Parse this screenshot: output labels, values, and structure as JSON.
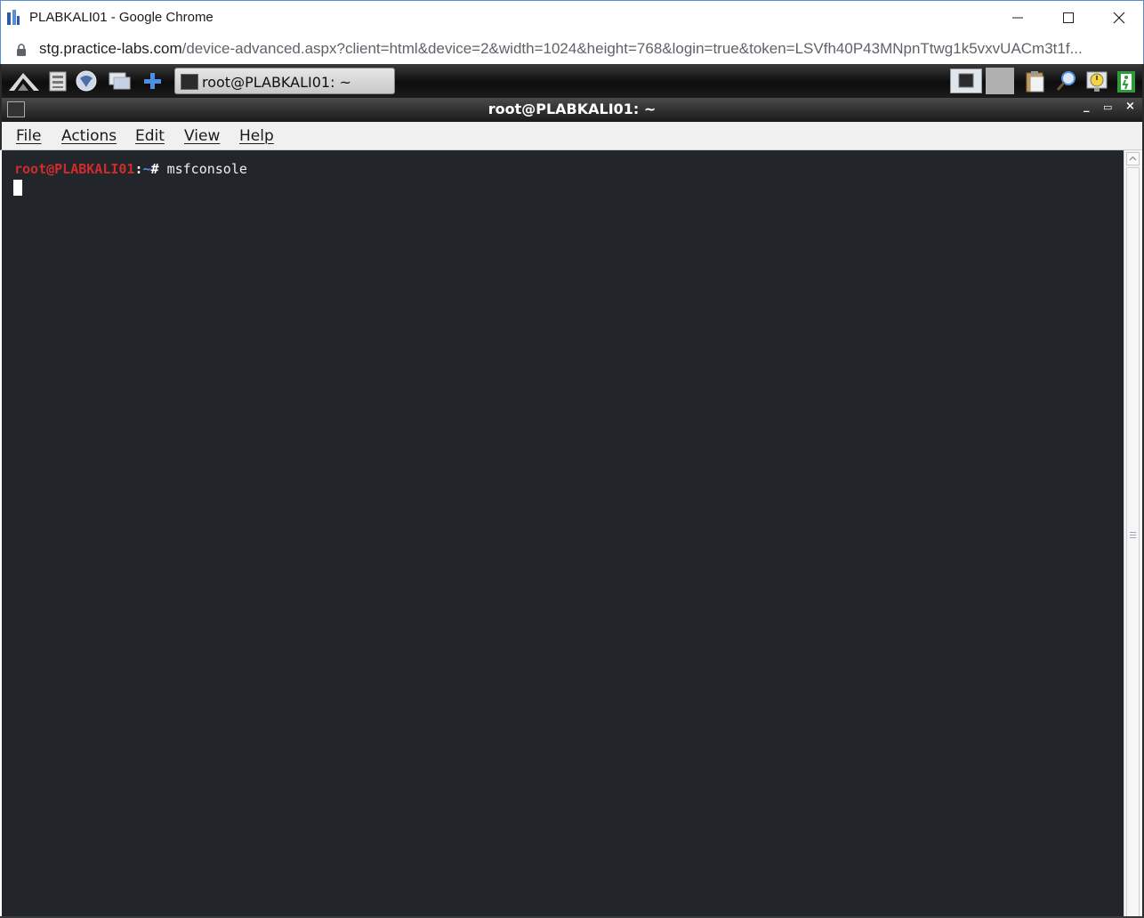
{
  "browser": {
    "window_title": "PLABKALI01 - Google Chrome",
    "url_host": "stg.practice-labs.com",
    "url_rest": "/device-advanced.aspx?client=html&device=2&width=1024&height=768&login=true&token=LSVfh40P43MNpnTtwg1k5vxvUACm3t1f..."
  },
  "panel": {
    "task_label": "root@PLABKALI01: ~",
    "icons": [
      "kali-menu-icon",
      "file-manager-icon",
      "web-browser-icon",
      "show-desktop-icon",
      "add-icon"
    ],
    "tray_icons": [
      "terminal-tray-icon",
      "clipboard-icon",
      "search-icon",
      "clock-icon",
      "logout-icon"
    ]
  },
  "terminal": {
    "window_title": "root@PLABKALI01: ~",
    "controls": {
      "minimize": "_",
      "maximize": "▭",
      "close": "×"
    },
    "menu": [
      "File",
      "Actions",
      "Edit",
      "View",
      "Help"
    ],
    "prompt_user": "root@PLABKALI01",
    "prompt_sep": ":",
    "prompt_path": "~",
    "prompt_hash": "#",
    "command": "msfconsole"
  },
  "colors": {
    "terminal_bg": "#22252a",
    "prompt_user": "#d02c2c",
    "prompt_path": "#4d8fe6"
  }
}
